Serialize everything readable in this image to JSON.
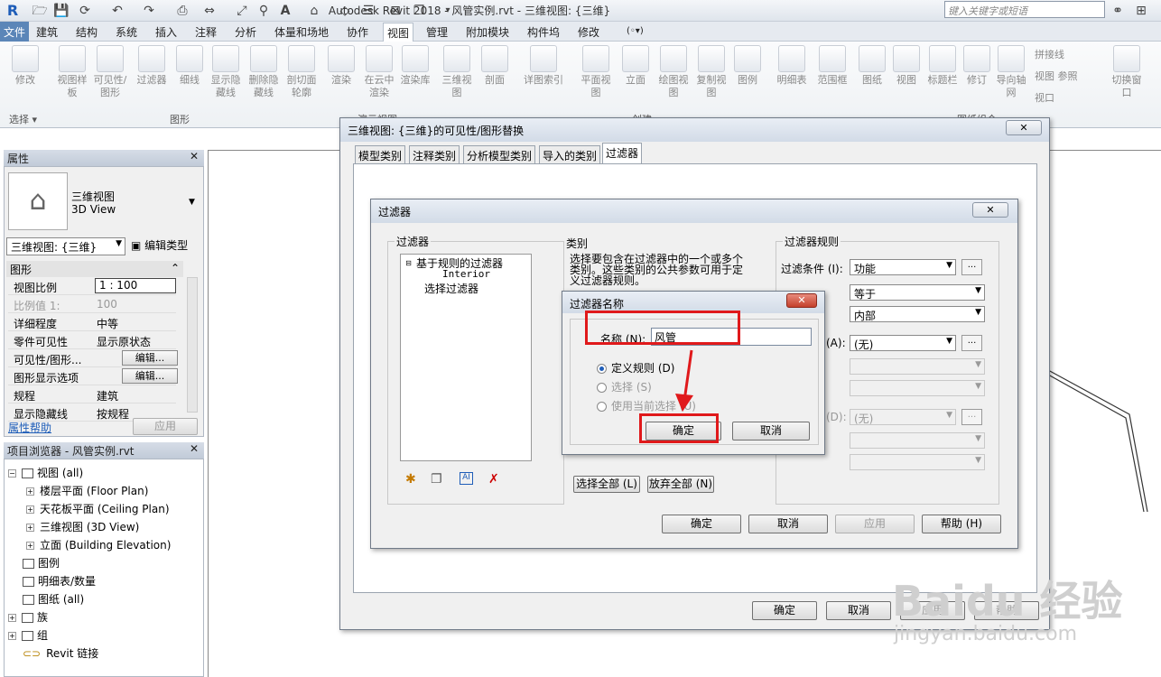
{
  "titlebar": {
    "title": "Autodesk Revit 2018 -    风管实例.rvt - 三维视图: {三维}",
    "search_placeholder": "键入关键字或短语"
  },
  "menu": [
    "文件",
    "建筑",
    "结构",
    "系统",
    "插入",
    "注释",
    "分析",
    "体量和场地",
    "协作",
    "视图",
    "管理",
    "附加模块",
    "构件坞",
    "修改"
  ],
  "ribbon": {
    "buttons": [
      "修改",
      "视图样板",
      "可见性/图形",
      "过滤器",
      "细线",
      "显示隐藏线",
      "删除隐藏线",
      "剖切面轮廓",
      "渲染",
      "在云中渲染",
      "渲染库",
      "三维视图",
      "剖面",
      "详图索引",
      "平面视图",
      "立面",
      "绘图视图",
      "复制视图",
      "图例",
      "明细表",
      "范围框",
      "图纸",
      "视图",
      "标题栏",
      "修订",
      "导向轴网",
      "拼接线",
      "视图 参照",
      "视口",
      "切换窗口"
    ],
    "groups": [
      "选择 ▾",
      "图形",
      "演示视图",
      "创建",
      "图纸组合"
    ]
  },
  "properties": {
    "title": "属性",
    "type_name": "三维视图",
    "type_name_en": "3D View",
    "selector": "三维视图: {三维}",
    "edit_type": "编辑类型",
    "section": "图形",
    "rows": [
      {
        "k": "视图比例",
        "v": "1 : 100"
      },
      {
        "k": "比例值 1:",
        "v": "100"
      },
      {
        "k": "详细程度",
        "v": "中等"
      },
      {
        "k": "零件可见性",
        "v": "显示原状态"
      },
      {
        "k": "可见性/图形...",
        "v": "编辑..."
      },
      {
        "k": "图形显示选项",
        "v": "编辑..."
      },
      {
        "k": "规程",
        "v": "建筑"
      },
      {
        "k": "显示隐藏线",
        "v": "按规程"
      }
    ],
    "help": "属性帮助",
    "apply": "应用"
  },
  "browser": {
    "title": "项目浏览器 - 风管实例.rvt",
    "items": [
      "视图 (all)",
      "楼层平面 (Floor Plan)",
      "天花板平面 (Ceiling Plan)",
      "三维视图 (3D View)",
      "立面 (Building Elevation)",
      "图例",
      "明细表/数量",
      "图纸 (all)",
      "族",
      "组",
      "Revit 链接"
    ]
  },
  "vg_dialog": {
    "title": "三维视图: {三维}的可见性/图形替换",
    "tabs": [
      "模型类别",
      "注释类别",
      "分析模型类别",
      "导入的类别",
      "过滤器"
    ],
    "ok": "确定",
    "cancel": "取消",
    "apply": "应用",
    "help": "帮助"
  },
  "filters_dialog": {
    "title": "过滤器",
    "filters_label": "过滤器",
    "tree": [
      "基于规则的过滤器",
      "Interior",
      "选择过滤器"
    ],
    "categories_label": "类别",
    "categories_desc": "选择要包含在过滤器中的一个或多个类别。这些类别的公共参数可用于定义过滤器规则。",
    "rules_label": "过滤器规则",
    "condition_label": "过滤条件 (I):",
    "condition_value": "功能",
    "operator": "等于",
    "value": "内部",
    "and_label": "(A):",
    "and_value": "(无)",
    "and2_label": "(D):",
    "and2_value": "(无)",
    "select_all": "选择全部 (L)",
    "check_none": "放弃全部 (N)",
    "ok": "确定",
    "cancel": "取消",
    "apply": "应用",
    "help": "帮助 (H)"
  },
  "name_dialog": {
    "title": "过滤器名称",
    "name_label": "名称 (N):",
    "name_value": "风管",
    "opt_define": "定义规则 (D)",
    "opt_select": "选择 (S)",
    "opt_current": "使用当前选择 (U)",
    "ok": "确定",
    "cancel": "取消"
  },
  "watermark": {
    "brand": "Baidu 经验",
    "url": "jingyan.baidu.com"
  },
  "colors": {
    "highlight": "#e0191b",
    "accent": "#1e5db8"
  }
}
